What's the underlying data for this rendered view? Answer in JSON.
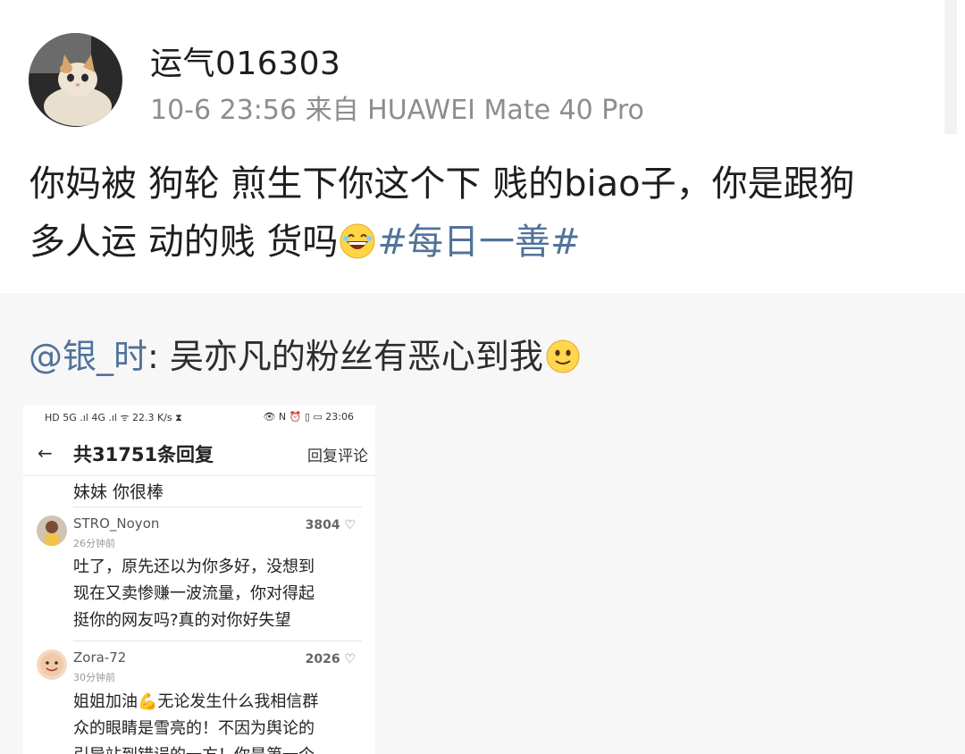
{
  "post": {
    "username": "运气016303",
    "meta": "10-6 23:56 来自 HUAWEI Mate 40 Pro",
    "content_line1": "你妈被 狗轮 煎生下你这个下 贱的biao子，你是跟狗",
    "content_line2": "多人运 动的贱 货吗",
    "hashtag": "#每日一善#",
    "avatar_icon": "cat-avatar-icon",
    "emoji_icon": "laughing-emoji-icon"
  },
  "repost": {
    "mention": "@银_时",
    "separator": ":",
    "text": " 吴亦凡的粉丝有恶心到我",
    "emoji_icon": "smile-emoji-icon"
  },
  "screenshot": {
    "status_bar_left": "HD 5G .ıl 4G .ıl ᯤ 22.3 K/s ⧗",
    "status_bar_right": "👁 N ⏰ ▯ ▭ 23:06",
    "back_glyph": "←",
    "title": "共31751条回复",
    "action": "回复评论",
    "prev_line": "妹妹 你很棒",
    "comments": [
      {
        "name": "STRO_Noyon",
        "time": "26分钟前",
        "likes": "3804 ♡",
        "line1": "吐了，原先还以为你多好，没想到",
        "line2": "现在又卖惨赚一波流量，你对得起",
        "line3": "挺你的网友吗?真的对你好失望"
      },
      {
        "name": "Zora-72",
        "time": "30分钟前",
        "likes": "2026 ♡",
        "line1": "姐姐加油💪无论发生什么我相信群",
        "line2": "众的眼睛是雪亮的！不因为舆论的",
        "line3": "引导站到错误的一方！你是第一个"
      }
    ]
  }
}
